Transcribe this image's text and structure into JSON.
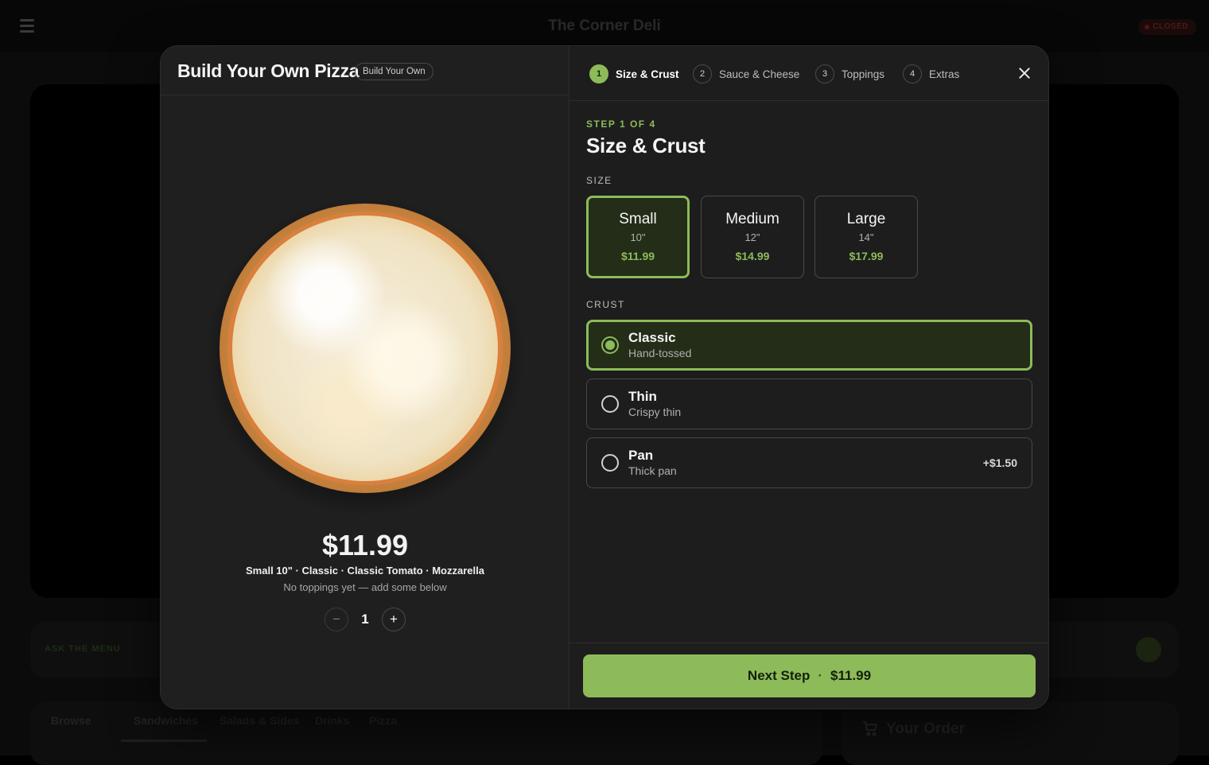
{
  "background": {
    "title": "The Corner Deli",
    "status": "CLOSED",
    "ask_label": "ASK THE MENU",
    "tabs": [
      "Browse",
      "Sandwiches",
      "Salads & Sides",
      "Drinks",
      "Pizza"
    ],
    "order_title": "Your Order"
  },
  "modal": {
    "title": "Build Your Own Pizza",
    "badge": "Build Your Own",
    "price": "$11.99",
    "summary": "Small 10\" · Classic · Classic Tomato · Mozzarella",
    "summary_sub": "No toppings yet — add some below",
    "quantity": "1",
    "qty_minus": "−",
    "qty_plus": "+"
  },
  "steps": [
    {
      "num": "1",
      "label": "Size & Crust",
      "active": true
    },
    {
      "num": "2",
      "label": "Sauce & Cheese",
      "active": false
    },
    {
      "num": "3",
      "label": "Toppings",
      "active": false
    },
    {
      "num": "4",
      "label": "Extras",
      "active": false
    }
  ],
  "step_page": {
    "kicker": "STEP 1 OF 4",
    "title": "Size & Crust",
    "size_label": "SIZE",
    "crust_label": "CRUST"
  },
  "sizes": [
    {
      "name": "Small",
      "inch": "10\"",
      "price": "$11.99",
      "selected": true
    },
    {
      "name": "Medium",
      "inch": "12\"",
      "price": "$14.99",
      "selected": false
    },
    {
      "name": "Large",
      "inch": "14\"",
      "price": "$17.99",
      "selected": false
    }
  ],
  "crusts": [
    {
      "name": "Classic",
      "desc": "Hand-tossed",
      "extra": "",
      "selected": true
    },
    {
      "name": "Thin",
      "desc": "Crispy thin",
      "extra": "",
      "selected": false
    },
    {
      "name": "Pan",
      "desc": "Thick pan",
      "extra": "+$1.50",
      "selected": false
    }
  ],
  "footer": {
    "next_label": "Next Step",
    "sep": "·",
    "next_price": "$11.99"
  },
  "colors": {
    "accent": "#8dbb5a",
    "modal_bg": "#1d1d1d"
  }
}
